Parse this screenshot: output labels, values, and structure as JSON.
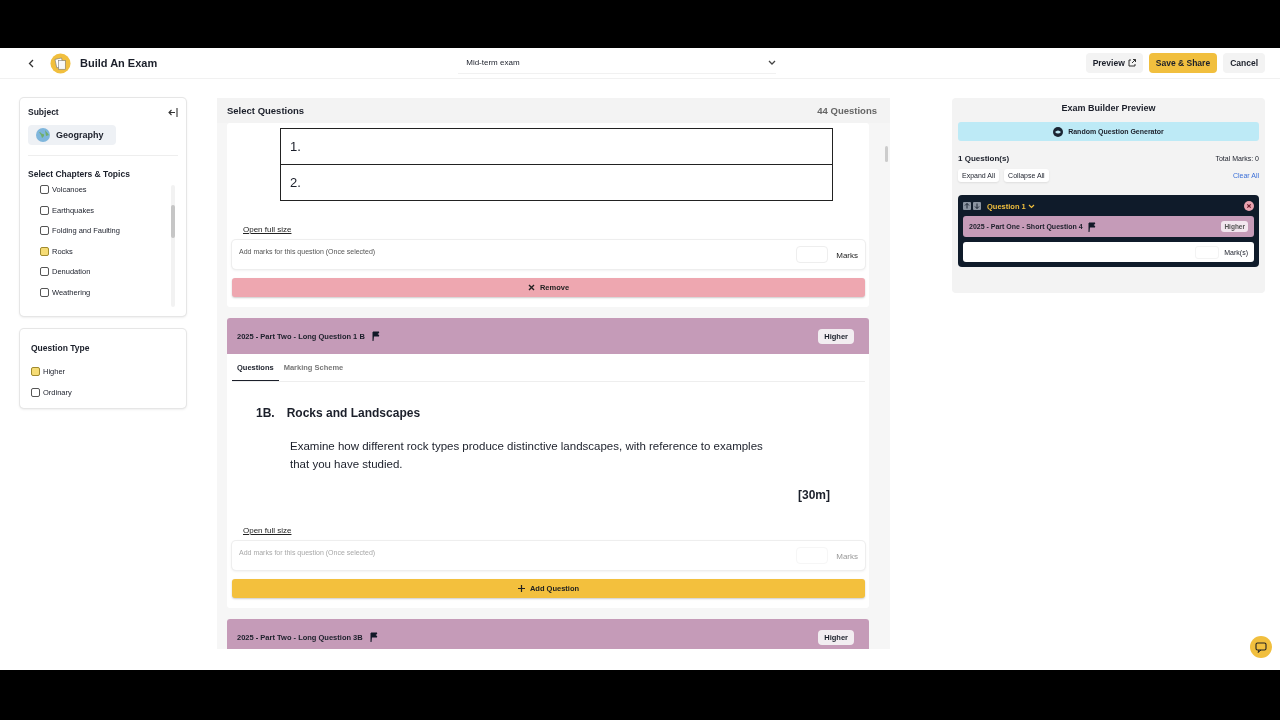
{
  "header": {
    "title": "Build An Exam",
    "exam_name": "Mid-term exam",
    "buttons": [
      {
        "label": "Preview",
        "kind": "secondary"
      },
      {
        "label": "Save & Share",
        "kind": "primary"
      },
      {
        "label": "Cancel",
        "kind": "plain"
      }
    ]
  },
  "sidebar": {
    "subject_title": "Subject",
    "subject": "Geography",
    "chapters_title": "Select Chapters & Topics",
    "chapters": [
      {
        "label": "Volcanoes",
        "checked": false
      },
      {
        "label": "Earthquakes",
        "checked": false
      },
      {
        "label": "Folding and Faulting",
        "checked": false
      },
      {
        "label": "Rocks",
        "checked": true
      },
      {
        "label": "Denudation",
        "checked": false
      },
      {
        "label": "Weathering",
        "checked": false
      }
    ],
    "type_title": "Question Type",
    "types": [
      {
        "label": "Higher",
        "checked": true
      },
      {
        "label": "Ordinary",
        "checked": false
      }
    ]
  },
  "questions": {
    "title": "Select Questions",
    "count": "44 Questions",
    "cards": [
      {
        "kind": "partial",
        "answer_rows": [
          "1.",
          "2."
        ],
        "link": "Open full size",
        "marks_placeholder": "Add marks for this question (Once selected)",
        "marks_label": "Marks",
        "marks_disabled": false,
        "action": {
          "kind": "remove",
          "label": "Remove"
        }
      },
      {
        "kind": "full",
        "title": "2025 - Part Two  - Long Question 1 B",
        "level": "Higher",
        "tabs": [
          {
            "label": "Questions",
            "selected": true
          },
          {
            "label": "Marking Scheme",
            "selected": false
          }
        ],
        "number": "1B.",
        "heading": "Rocks and Landscapes",
        "body": "Examine how different rock types produce distinctive landscapes, with reference to examples that you have studied.",
        "marks": "[30m]",
        "link": "Open full size",
        "marks_placeholder": "Add marks for this question (Once selected)",
        "marks_label": "Marks",
        "marks_disabled": true,
        "action": {
          "kind": "add",
          "label": "Add Question"
        }
      },
      {
        "kind": "header",
        "title": "2025 - Part Two  - Long Question 3B",
        "level": "Higher"
      }
    ]
  },
  "preview": {
    "title": "Exam Builder Preview",
    "generator": "Random Question Generator",
    "count": "1 Question(s)",
    "total": "Total Marks: 0",
    "buttons": [
      "Expand All",
      "Collapse All"
    ],
    "clear": "Clear All",
    "question": {
      "title": "Question 1",
      "expanded": true,
      "item": "2025 - Part One - Short Question 4",
      "level": "Higher",
      "marks_label": "Mark(s)"
    }
  }
}
